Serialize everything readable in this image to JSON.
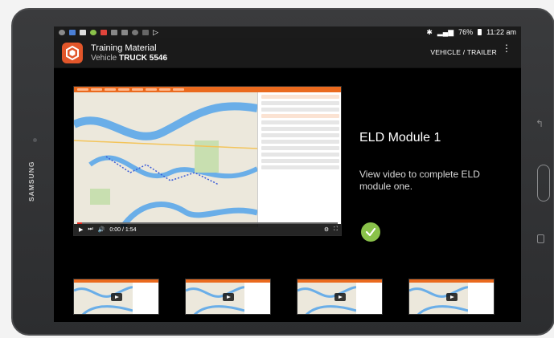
{
  "device": {
    "brand": "SAMSUNG"
  },
  "status_bar": {
    "battery": "76%",
    "time": "11:22 am"
  },
  "app_bar": {
    "title": "Training Material",
    "vehicle_label": "Vehicle",
    "vehicle_value": "TRUCK 5546",
    "action": "VEHICLE / TRAILER",
    "menu_icon": "more-vert-icon"
  },
  "module": {
    "title": "ELD Module 1",
    "description": "View video to complete ELD module one.",
    "status_icon": "check-circle-icon",
    "status_color": "#8ac24a"
  },
  "video": {
    "elapsed": "0:00 / 1:54",
    "progress": 0.0
  },
  "thumbnails": [
    {
      "name": "thumb-1"
    },
    {
      "name": "thumb-2"
    },
    {
      "name": "thumb-3"
    },
    {
      "name": "thumb-4"
    }
  ],
  "colors": {
    "accent": "#e2562a",
    "background": "#000000"
  }
}
